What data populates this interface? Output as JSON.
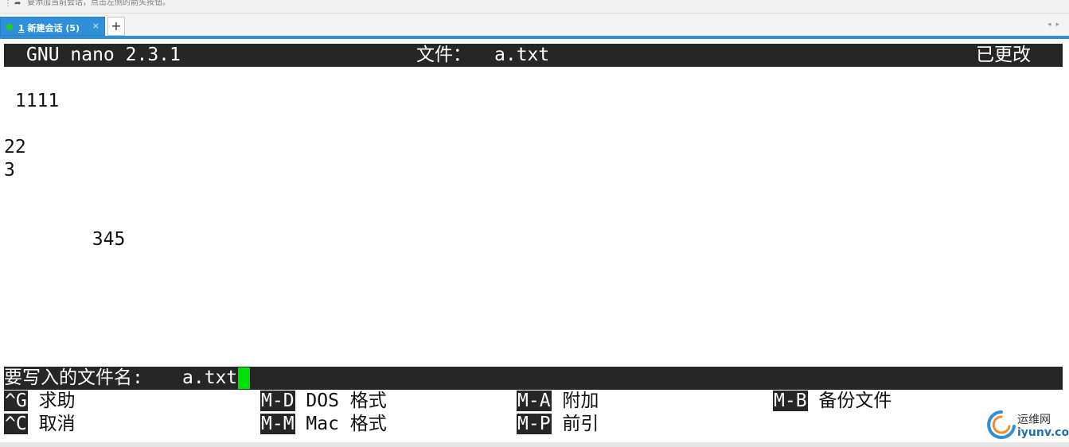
{
  "top_hint": "要添加当前会话，点击左侧的箭头按钮。",
  "tab": {
    "number": "1",
    "title": "新建会话 (5)",
    "close_glyph": "×",
    "status_color": "#19d21e"
  },
  "new_tab_glyph": "+",
  "scroll_arrows": "◂▸",
  "nano": {
    "version": "GNU nano 2.3.1",
    "file_label": "文件：",
    "file_name": "a.txt",
    "modified": "已更改",
    "content_lines": [
      " 1111",
      "",
      "22",
      "3",
      "",
      "",
      "",
      "        345"
    ],
    "prompt_label": "要写入的文件名: ",
    "prompt_value": "a.txt",
    "cursor_color": "#00e000",
    "shortcuts": [
      {
        "key": "^G",
        "label": "求助"
      },
      {
        "key": "M-D",
        "label": "DOS 格式"
      },
      {
        "key": "M-A",
        "label": "附加"
      },
      {
        "key": "M-B",
        "label": "备份文件"
      },
      {
        "key": "^C",
        "label": "取消"
      },
      {
        "key": "M-M",
        "label": "Mac 格式"
      },
      {
        "key": "M-P",
        "label": "前引"
      }
    ]
  },
  "watermark": {
    "cn": "运维网",
    "en": "iyunv.com"
  }
}
